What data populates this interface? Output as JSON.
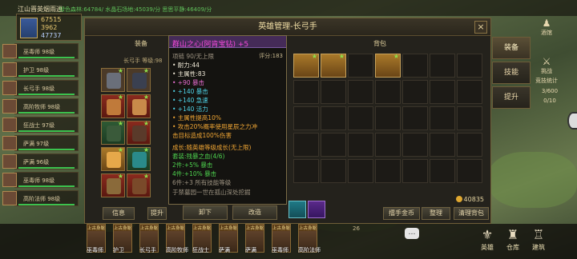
{
  "top": {
    "server": "江山晋英烟雨逍",
    "zones": "绿色森林:64784/ 水晶石场地:45039/分 思思平静:46409/分"
  },
  "resources": [
    {
      "value": "67515",
      "color": "#e8c870"
    },
    {
      "value": "3962",
      "color": "#e8c870"
    },
    {
      "value": "47737",
      "color": "#b8d0ff"
    }
  ],
  "heroes": [
    {
      "name": "巫毒师 98级"
    },
    {
      "name": "护卫 98级"
    },
    {
      "name": "长弓手 98级"
    },
    {
      "name": "高阶牧师 98级"
    },
    {
      "name": "狂战士 97级"
    },
    {
      "name": "萨满 97级"
    },
    {
      "name": "萨满 96级"
    },
    {
      "name": "巫毒师 98级"
    },
    {
      "name": "高阶法师 98级"
    }
  ],
  "panel": {
    "title": "英雄管理-长弓手",
    "close": "×",
    "equip_header": "装备",
    "bag_header": "背包",
    "hero_level": "长弓手 等级:98",
    "gold": "40835",
    "buttons": {
      "info": "信息",
      "promote": "提升",
      "unequip": "卸下",
      "reforge": "改造",
      "sell_all": "擂手金币",
      "sort": "整理",
      "clear_bag": "清理背包"
    }
  },
  "tooltip": {
    "name": "群山之心(阿肯宝钻) +5",
    "req": "项链 90/无上限",
    "score": "评分:183",
    "lines": [
      {
        "text": "• 耐力:44",
        "color": "white"
      },
      {
        "text": "• 主属性:83",
        "color": "white"
      },
      {
        "text": "• +90 暴击",
        "color": "pink"
      },
      {
        "text": "• +140 暴击",
        "color": "cyan"
      },
      {
        "text": "• +140 急速",
        "color": "cyan"
      },
      {
        "text": "• +140 活力",
        "color": "cyan"
      },
      {
        "text": "• 主属性提高10%",
        "color": "orange"
      },
      {
        "text": "• 攻击20%概率使用星辰之力冲",
        "color": "orange"
      },
      {
        "text": "击目标造成100%伤害",
        "color": "orange"
      },
      {
        "text": "成长:随英雄等级成长(无上限)",
        "color": "orange"
      },
      {
        "text": "套装:残暴之血(4/6)",
        "color": "green"
      },
      {
        "text": "2件:+5% 暴击",
        "color": "green"
      },
      {
        "text": "4件:+10% 暴击",
        "color": "green"
      },
      {
        "text": "6件:+3 所有技能等级",
        "color": "grey"
      },
      {
        "text": "于禁墓园一世在孤山深处挖掘",
        "color": "grey"
      }
    ]
  },
  "side_tabs": [
    "装备",
    "技能",
    "提升"
  ],
  "right_strip": [
    "酒馆",
    "挑战",
    "竞技统计"
  ],
  "right_counter": "3/600",
  "right_counter2": "0/10",
  "bottom_heroes": [
    "巫毒师",
    "护卫",
    "长弓手",
    "高阶牧师",
    "狂战士",
    "萨满",
    "萨满",
    "巫毒师",
    "高阶法师"
  ],
  "bottom_hero_tag": "上古身躯",
  "bottom_count": "26",
  "bottom_nav": [
    {
      "label": "英雄",
      "glyph": "⚜"
    },
    {
      "label": "仓库",
      "glyph": "♜"
    },
    {
      "label": "建筑",
      "glyph": "♖"
    }
  ],
  "chat": "…"
}
